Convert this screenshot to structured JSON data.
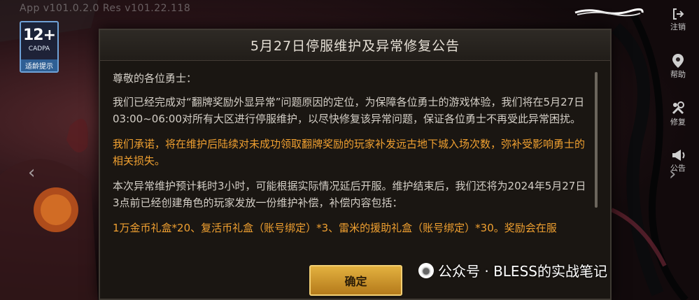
{
  "app_version": "App v101.0.2.0 Res v101.22.118",
  "age_badge": {
    "rating": "12+",
    "org": "CADPA",
    "tip": "适龄提示"
  },
  "side_nav": [
    {
      "label": "注销",
      "icon": "logout-icon"
    },
    {
      "label": "帮助",
      "icon": "help-icon"
    },
    {
      "label": "修复",
      "icon": "repair-icon"
    },
    {
      "label": "公告",
      "icon": "announcement-icon"
    }
  ],
  "nav_arrows": {
    "prev": "‹",
    "next": "›"
  },
  "dialog": {
    "title": "5月27日停服维护及异常修复公告",
    "greeting": "尊敬的各位勇士：",
    "para1": "我们已经完成对“翻牌奖励外显异常”问题原因的定位，为保障各位勇士的游戏体验，我们将在5月27日03:00~06:00对所有大区进行停服维护，以尽快修复该异常问题，保证各位勇士不再受此异常困扰。",
    "para2": "我们承诺，将在维护后陆续对未成功领取翻牌奖励的玩家补发远古地下城入场次数，弥补受影响勇士的相关损失。",
    "para3": "本次异常维护预计耗时3小时，可能根据实际情况延后开服。维护结束后，我们还将为2024年5月27日3点前已经创建角色的玩家发放一份维护补偿，补偿内容包括：",
    "para4": "1万金币礼盒*20、复活币礼盒（账号绑定）*3、雷米的援助礼盒（账号绑定）*30。奖励会在服",
    "confirm_label": "确定"
  },
  "watermark": "公众号 · BLESS的实战笔记",
  "colors": {
    "highlight": "#f0a030",
    "button": "#d9a334"
  }
}
